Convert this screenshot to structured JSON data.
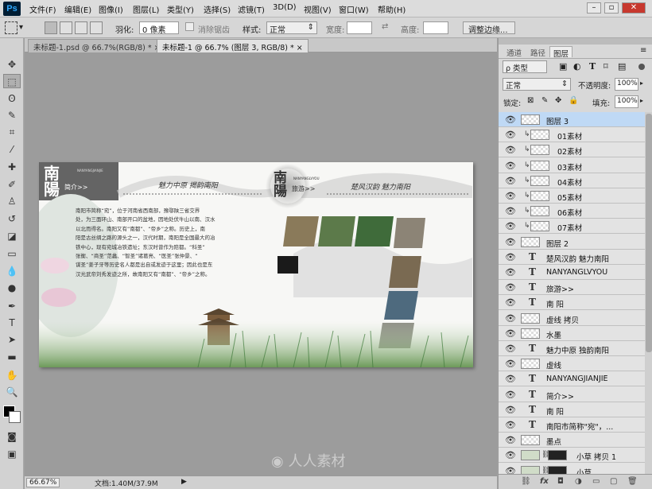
{
  "app": {
    "logo": "Ps"
  },
  "menu": [
    "文件(F)",
    "编辑(E)",
    "图像(I)",
    "图层(L)",
    "类型(Y)",
    "选择(S)",
    "滤镜(T)",
    "3D(D)",
    "视图(V)",
    "窗口(W)",
    "帮助(H)"
  ],
  "window_controls": {
    "minimize": "–",
    "restore": "▫",
    "close": "✕"
  },
  "options": {
    "feather_label": "羽化:",
    "feather_value": "0 像素",
    "antialias_label": "消除锯齿",
    "style_label": "样式:",
    "style_value": "正常",
    "width_label": "宽度:",
    "height_label": "高度:",
    "refine_button": "调整边缘..."
  },
  "tabs": [
    {
      "label": "未标题-1.psd @ 66.7%(RGB/8) *",
      "close": "×"
    },
    {
      "label": "未标题-1 @ 66.7% (图层 3, RGB/8) *",
      "close": "×"
    }
  ],
  "status": {
    "zoom": "66.67%",
    "doc_info": "文档:1.40M/37.9M"
  },
  "watermark": "人人素材",
  "panel": {
    "tabs": [
      "通道",
      "路径",
      "图层"
    ],
    "filter_kind": "ρ 类型",
    "blend_mode": "正常",
    "opacity_label": "不透明度:",
    "opacity_value": "100%",
    "lock_label": "锁定:",
    "fill_label": "填充:",
    "fill_value": "100%",
    "layers": [
      {
        "name": "图层 3",
        "kind": "raster",
        "selected": true
      },
      {
        "name": "01素材",
        "kind": "clip"
      },
      {
        "name": "02素材",
        "kind": "clip"
      },
      {
        "name": "03素材",
        "kind": "clip"
      },
      {
        "name": "04素材",
        "kind": "clip"
      },
      {
        "name": "05素材",
        "kind": "clip"
      },
      {
        "name": "06素材",
        "kind": "clip"
      },
      {
        "name": "07素材",
        "kind": "clip"
      },
      {
        "name": "图层 2",
        "kind": "raster"
      },
      {
        "name": "楚风汉韵 魅力南阳",
        "kind": "text"
      },
      {
        "name": "NANYANGLVYOU",
        "kind": "text"
      },
      {
        "name": "旅游>>",
        "kind": "text"
      },
      {
        "name": "南 阳",
        "kind": "text"
      },
      {
        "name": "虚线 拷贝",
        "kind": "raster"
      },
      {
        "name": "水墨",
        "kind": "raster"
      },
      {
        "name": "魅力中原 独韵南阳",
        "kind": "text"
      },
      {
        "name": "虚线",
        "kind": "raster"
      },
      {
        "name": "NANYANGJIANJIE",
        "kind": "text"
      },
      {
        "name": "简介>>",
        "kind": "text"
      },
      {
        "name": "南 阳",
        "kind": "text"
      },
      {
        "name": "南阳市简称\"宛\"，...",
        "kind": "text"
      },
      {
        "name": "墨点",
        "kind": "raster"
      },
      {
        "name": "小草 拷贝 1",
        "kind": "mask"
      },
      {
        "name": "小草",
        "kind": "mask"
      }
    ]
  },
  "artwork": {
    "left_title": "南陽",
    "left_subtitle": "简介>>",
    "left_pinyin": "NANYANGJIANJIE",
    "left_slogan": "魅力中原  揭韵南阳",
    "right_title": "南陽",
    "right_subtitle": "旅游>>",
    "right_pinyin": "NANYANGLVYOU",
    "right_slogan": "楚风汉韵  魅力南阳",
    "body_lines": [
      "南阳市简称“宛”，位于河南省西南部，豫鄂陕三省交界",
      "处，为三面环山、南部开口的盆地，因地处伏牛山以南、汉水",
      "以北而得名。南阳又有“南都”、“帝乡”之称。历史上，南",
      "阳是古丝绸之路的源头之一，汉代时期，南阳是全国最大的冶",
      "铁中心，现有宛城冶铁遗址；东汉时曾作为陪都。“科圣”",
      "张衡、“商圣”范蠡、“智圣”诸葛亮、“医圣”张仲景、“",
      "谋圣”姜子牙等历史名人都是出自或发迹于这里；因此也是东",
      "汉光武帝刘秀发迹之所，故南阳又有“南都”、“帝乡”之称。"
    ]
  }
}
